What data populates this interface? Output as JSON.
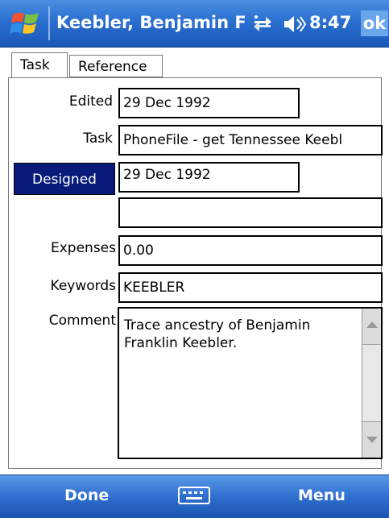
{
  "titlebar": {
    "title": "Keebler, Benjamin Fi",
    "time": "8:47",
    "ok_label": "ok",
    "icons": [
      "windows-start-icon",
      "connectivity-icon",
      "speaker-icon"
    ]
  },
  "tabs": [
    {
      "label": "Task",
      "active": true
    },
    {
      "label": "Reference",
      "active": false
    }
  ],
  "form": {
    "edited_label": "Edited",
    "edited_value": "29 Dec 1992",
    "task_label": "Task",
    "task_value": "PhoneFile - get Tennessee Keebl",
    "designed_label": "Designed",
    "designed_value": "29 Dec 1992",
    "blank_value": "",
    "expenses_label": "Expenses",
    "expenses_value": "0.00",
    "keywords_label": "Keywords",
    "keywords_value": "KEEBLER",
    "comment_label": "Comment",
    "comment_value": "Trace ancestry of Benjamin Franklin Keebler."
  },
  "bottombar": {
    "left_softkey": "Done",
    "right_softkey": "Menu",
    "keyboard_icon": "keyboard-icon"
  },
  "colors": {
    "titlebar_blue": "#2a6fd0",
    "selected_button": "#081a7a",
    "ok_button": "#6aa6ec"
  }
}
